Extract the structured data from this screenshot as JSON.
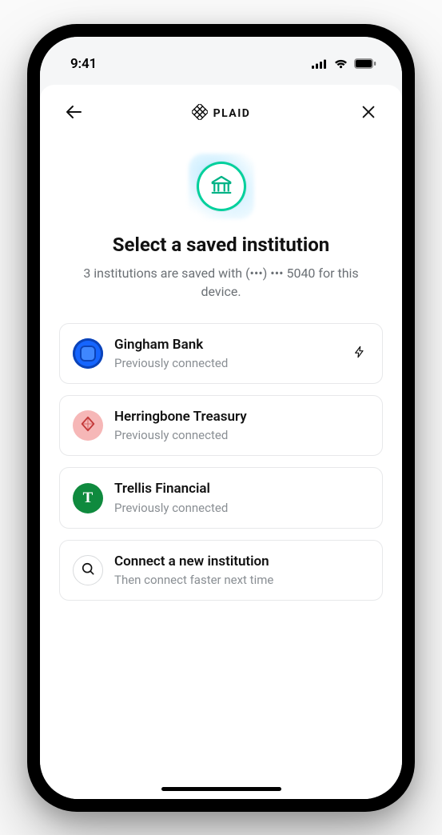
{
  "statusbar": {
    "time": "9:41"
  },
  "header": {
    "brand": "PLAID"
  },
  "hero": {
    "title": "Select a saved institution",
    "subtitle": "3 institutions are saved with (•••) ••• 5040 for this device."
  },
  "institutions": [
    {
      "name": "Gingham Bank",
      "sub": "Previously connected",
      "icon": "gingham",
      "fast": true
    },
    {
      "name": "Herringbone Treasury",
      "sub": "Previously connected",
      "icon": "herringbone",
      "fast": false
    },
    {
      "name": "Trellis Financial",
      "sub": "Previously connected",
      "icon": "trellis",
      "fast": false
    }
  ],
  "connect_new": {
    "title": "Connect a new institution",
    "sub": "Then connect faster next time"
  },
  "trellis_glyph": "T"
}
